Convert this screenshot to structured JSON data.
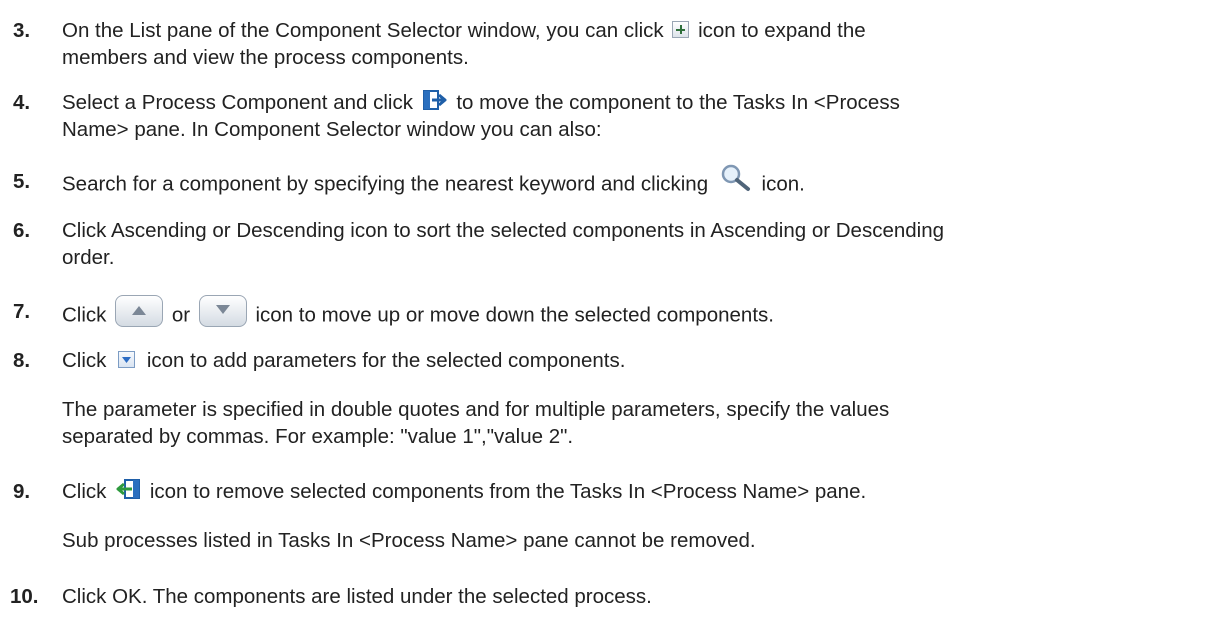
{
  "steps": [
    {
      "number": "3.",
      "lines": [
        {
          "before": "On the List pane of the Component Selector window, you can click",
          "icon": "expand-plus-icon",
          "after": "icon to expand the"
        },
        {
          "text": "members and view the process components."
        }
      ]
    },
    {
      "number": "4.",
      "lines": [
        {
          "before": "Select a Process Component and click",
          "icon": "move-right-icon",
          "after": "to move the component to the Tasks In <Process"
        },
        {
          "text": "Name> pane. In Component Selector window you can also:"
        }
      ]
    },
    {
      "number": "5.",
      "lines": [
        {
          "before": "Search for a component by specifying the nearest keyword and clicking",
          "icon": "magnifier-icon",
          "after": "icon."
        }
      ]
    },
    {
      "number": "6.",
      "lines": [
        {
          "text": "Click Ascending or Descending icon to sort the selected components in Ascending or Descending"
        },
        {
          "text": "order."
        }
      ]
    },
    {
      "number": "7.",
      "lines": [
        {
          "before": "Click",
          "icon": "move-up-icon",
          "middle": "or",
          "icon2": "move-down-icon",
          "after": "icon to move up or move down the selected components."
        }
      ]
    },
    {
      "number": "8.",
      "lines": [
        {
          "before": "Click",
          "icon": "dropdown-parameters-icon",
          "after": "icon to add parameters for the selected components."
        }
      ],
      "note_lines": [
        "The parameter is specified in double quotes and for multiple parameters, specify the values",
        "separated by commas. For example: \"value 1\",\"value 2\"."
      ]
    },
    {
      "number": "9.",
      "lines": [
        {
          "before": "Click",
          "icon": "remove-left-icon",
          "after": "icon to remove selected components from the Tasks In <Process Name> pane."
        }
      ],
      "note_lines": [
        "Sub processes listed in Tasks In <Process Name> pane cannot be removed."
      ]
    },
    {
      "number": "10.",
      "lines": [
        {
          "text": "Click OK. The components are listed under the selected process."
        }
      ]
    }
  ]
}
